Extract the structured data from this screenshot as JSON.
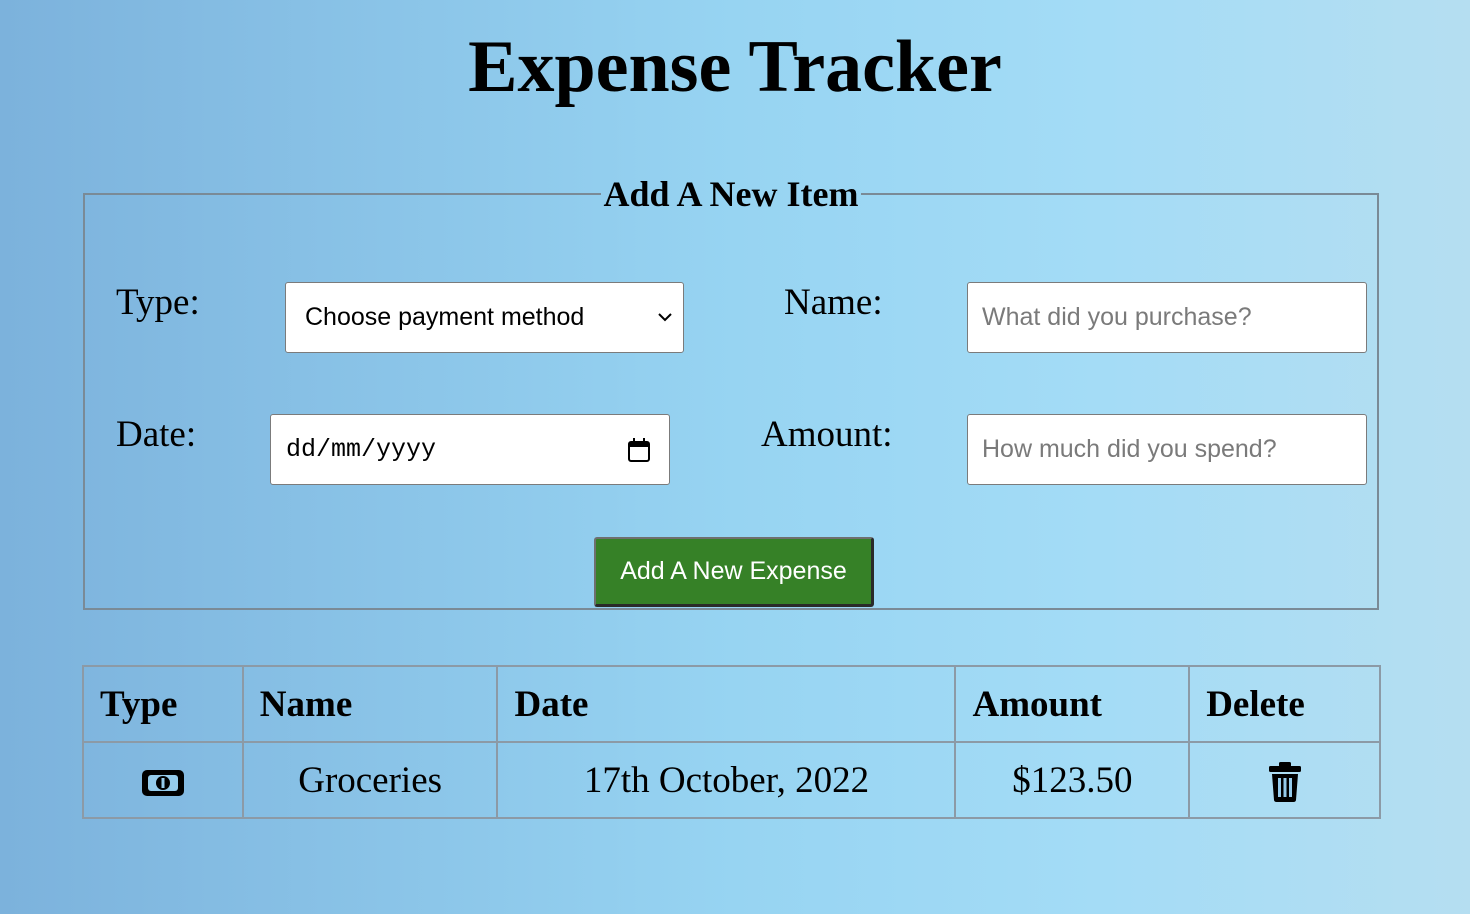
{
  "header": {
    "title": "Expense Tracker"
  },
  "form": {
    "legend": "Add A New Item",
    "type_label": "Type:",
    "type_select_value": "Choose payment method",
    "name_label": "Name:",
    "name_placeholder": "What did you purchase?",
    "date_label": "Date:",
    "date_placeholder": "dd/mm/yyyy",
    "amount_label": "Amount:",
    "amount_placeholder": "How much did you spend?",
    "submit_label": "Add A New Expense"
  },
  "table": {
    "columns": [
      "Type",
      "Name",
      "Date",
      "Amount",
      "Delete"
    ],
    "rows": [
      {
        "type_icon": "money-bill-icon",
        "name": "Groceries",
        "date": "17th October, 2022",
        "amount": "$123.50",
        "delete_icon": "trash-icon"
      }
    ]
  },
  "colors": {
    "button_green": "#368127",
    "background_left": "#7cb2dc",
    "background_right": "#b5def1"
  }
}
